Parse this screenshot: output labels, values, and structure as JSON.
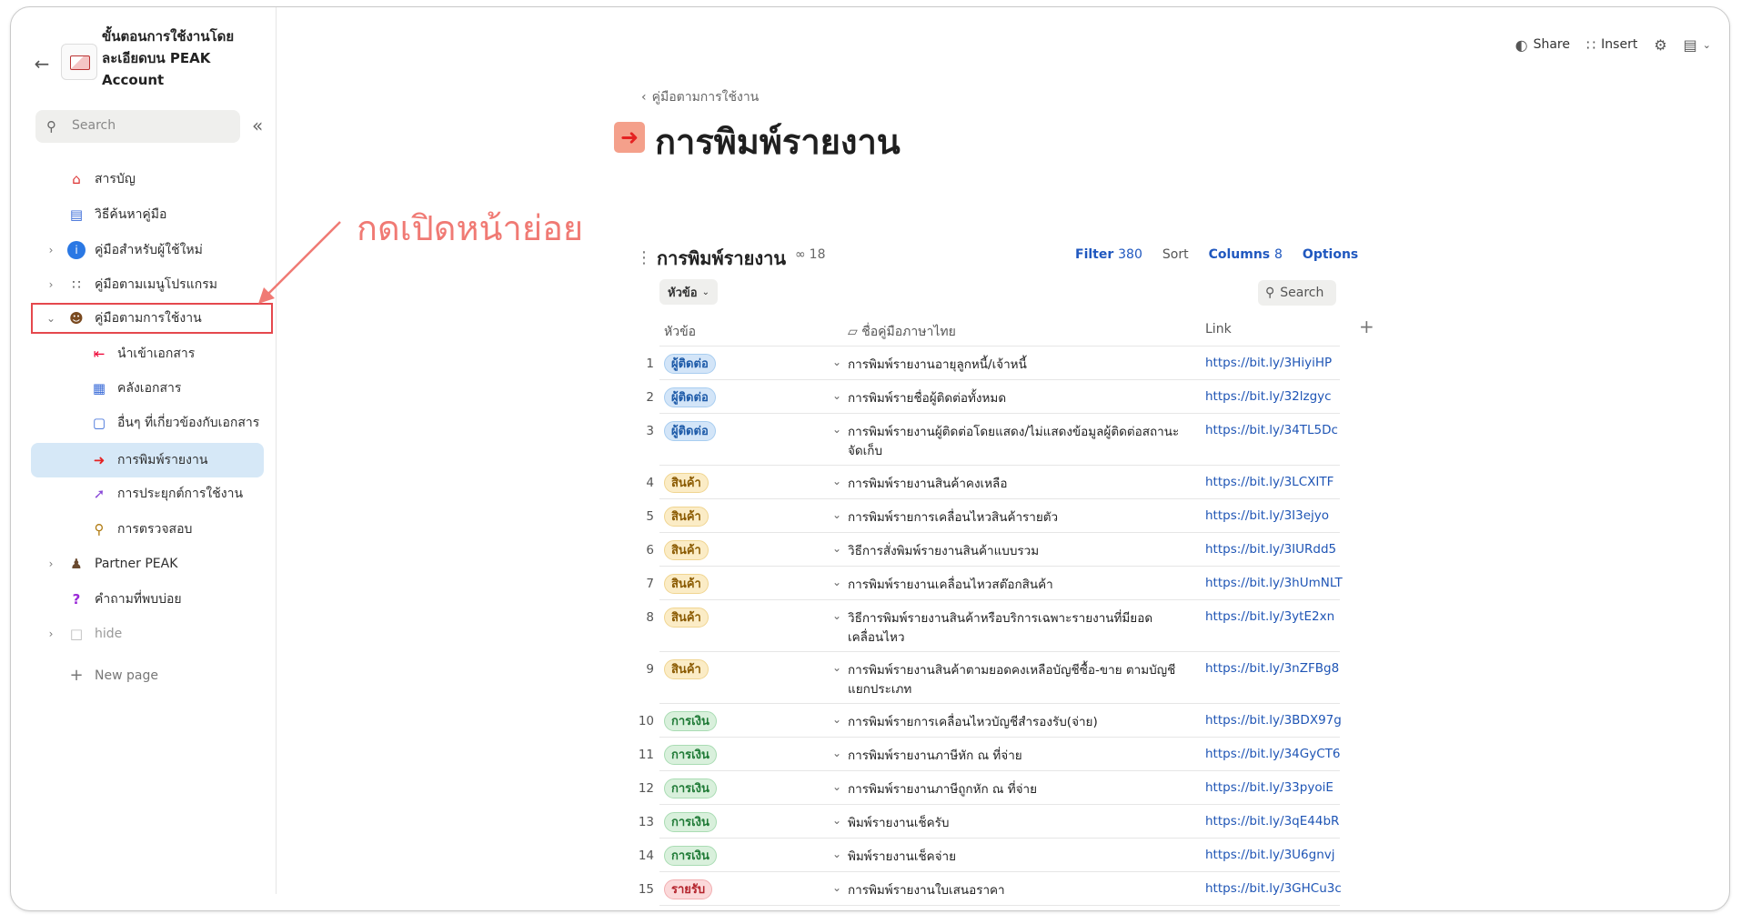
{
  "workspace": {
    "title_lines": [
      "ขั้นตอนการใช้งานโดย",
      "ละเอียดบน PEAK",
      "Account"
    ]
  },
  "sidebar": {
    "search_placeholder": "Search",
    "items": [
      {
        "label": "สารบัญ",
        "icon": "house-icon"
      },
      {
        "label": "วิธีค้นหาคู่มือ",
        "icon": "search-doc-icon"
      },
      {
        "label": "คู่มือสำหรับผู้ใช้ใหม่",
        "icon": "info-icon"
      },
      {
        "label": "คู่มือตามเมนูโปรแกรม",
        "icon": "grid-icon"
      },
      {
        "label": "คู่มือตามการใช้งาน",
        "icon": "person-icon"
      },
      {
        "label": "นำเข้าเอกสาร",
        "icon": "import-icon"
      },
      {
        "label": "คลังเอกสาร",
        "icon": "docs-icon"
      },
      {
        "label": "อื่นๆ ที่เกี่ยวข้องกับเอกสาร",
        "icon": "page-icon"
      },
      {
        "label": "การพิมพ์รายงาน",
        "icon": "right-arrow-icon"
      },
      {
        "label": "การประยุกต์การใช้งาน",
        "icon": "rocket-icon"
      },
      {
        "label": "การตรวจสอบ",
        "icon": "magnifier-icon"
      },
      {
        "label": "Partner PEAK",
        "icon": "people-icon"
      },
      {
        "label": "คำถามที่พบบ่อย",
        "icon": "question-icon"
      },
      {
        "label": "hide",
        "icon": "blank-page-icon"
      },
      {
        "label": "New page",
        "icon": "plus-icon"
      }
    ]
  },
  "topbar": {
    "share": "Share",
    "insert": "Insert"
  },
  "annotation": {
    "text": "กดเปิดหน้าย่อย",
    "color": "#f07a74"
  },
  "page": {
    "breadcrumb": "คู่มือตามการใช้งาน",
    "title": "การพิมพ์รายงาน"
  },
  "database": {
    "title": "การพิมพ์รายงาน",
    "link_count": "18",
    "filter_label": "Filter",
    "filter_count": "380",
    "sort_label": "Sort",
    "columns_label": "Columns",
    "columns_count": "8",
    "options_label": "Options",
    "group_chip": "หัวข้อ",
    "search_label": "Search",
    "headers": {
      "topic": "หัวข้อ",
      "name": "ชื่อคู่มือภาษาไทย",
      "link": "Link"
    },
    "rows": [
      {
        "num": "1",
        "tag": "ผู้ติดต่อ",
        "tag_type": "contact",
        "name": "การพิมพ์รายงานอายุลูกหนี้/เจ้าหนี้",
        "link": "https://bit.ly/3HiyiHP"
      },
      {
        "num": "2",
        "tag": "ผู้ติดต่อ",
        "tag_type": "contact",
        "name": "การพิมพ์รายชื่อผู้ติดต่อทั้งหมด",
        "link": "https://bit.ly/32lzgyc"
      },
      {
        "num": "3",
        "tag": "ผู้ติดต่อ",
        "tag_type": "contact",
        "name": "การพิมพ์รายงานผู้ติดต่อโดยแสดง/ไม่แสดงข้อมูลผู้ติดต่อสถานะจัดเก็บ",
        "link": "https://bit.ly/34TL5Dc"
      },
      {
        "num": "4",
        "tag": "สินค้า",
        "tag_type": "product",
        "name": "การพิมพ์รายงานสินค้าคงเหลือ",
        "link": "https://bit.ly/3LCXITF"
      },
      {
        "num": "5",
        "tag": "สินค้า",
        "tag_type": "product",
        "name": "การพิมพ์รายการเคลื่อนไหวสินค้ารายตัว",
        "link": "https://bit.ly/3I3ejyo"
      },
      {
        "num": "6",
        "tag": "สินค้า",
        "tag_type": "product",
        "name": "วิธีการสั่งพิมพ์รายงานสินค้าแบบรวม",
        "link": "https://bit.ly/3IURdd5"
      },
      {
        "num": "7",
        "tag": "สินค้า",
        "tag_type": "product",
        "name": "การพิมพ์รายงานเคลื่อนไหวสต๊อกสินค้า",
        "link": "https://bit.ly/3hUmNLT"
      },
      {
        "num": "8",
        "tag": "สินค้า",
        "tag_type": "product",
        "name": "วิธีการพิมพ์รายงานสินค้าหรือบริการเฉพาะรายงานที่มียอดเคลื่อนไหว",
        "link": "https://bit.ly/3ytE2xn"
      },
      {
        "num": "9",
        "tag": "สินค้า",
        "tag_type": "product",
        "name": "การพิมพ์รายงานสินค้าตามยอดคงเหลือบัญชีซื้อ-ขาย ตามบัญชีแยกประเภท",
        "link": "https://bit.ly/3nZFBg8"
      },
      {
        "num": "10",
        "tag": "การเงิน",
        "tag_type": "finance",
        "name": "การพิมพ์รายการเคลื่อนไหวบัญชีสำรองรับ(จ่าย)",
        "link": "https://bit.ly/3BDX97g"
      },
      {
        "num": "11",
        "tag": "การเงิน",
        "tag_type": "finance",
        "name": "การพิมพ์รายงานภาษีหัก ณ ที่จ่าย",
        "link": "https://bit.ly/34GyCT6"
      },
      {
        "num": "12",
        "tag": "การเงิน",
        "tag_type": "finance",
        "name": "การพิมพ์รายงานภาษีถูกหัก ณ ที่จ่าย",
        "link": "https://bit.ly/33pyoiE"
      },
      {
        "num": "13",
        "tag": "การเงิน",
        "tag_type": "finance",
        "name": "พิมพ์รายงานเช็ครับ",
        "link": "https://bit.ly/3qE44bR"
      },
      {
        "num": "14",
        "tag": "การเงิน",
        "tag_type": "finance",
        "name": "พิมพ์รายงานเช็คจ่าย",
        "link": "https://bit.ly/3U6gnvj"
      },
      {
        "num": "15",
        "tag": "รายรับ",
        "tag_type": "income",
        "name": "การพิมพ์รายงานใบเสนอราคา",
        "link": "https://bit.ly/3GHCu3c"
      }
    ]
  }
}
